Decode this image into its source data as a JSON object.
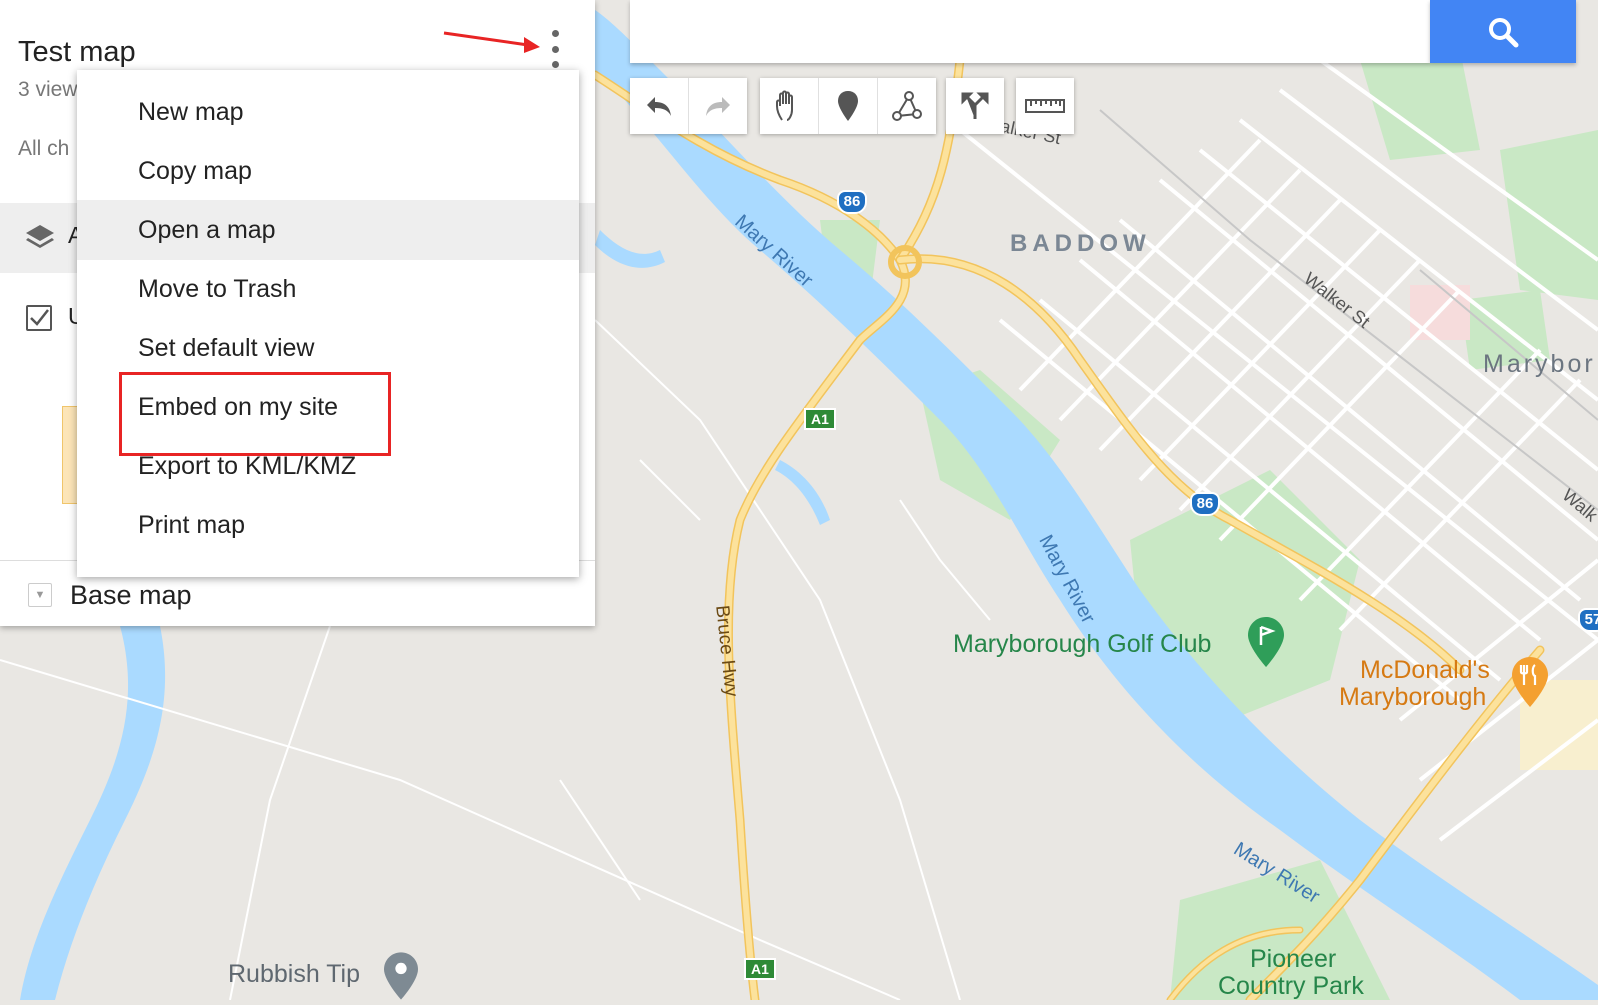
{
  "map": {
    "labels": {
      "baddow": "BADDOW",
      "maryborough_partial": "Marybor",
      "walker_st_1": "alker St",
      "walker_st_2": "Walker St",
      "walker_st_3": "Walk",
      "mary_river_1": "Mary River",
      "mary_river_2": "Mary River",
      "mary_river_3": "Mary River",
      "bruce_hwy": "Bruce Hwy",
      "golf_club": "Maryborough Golf Club",
      "mcdonalds_line1": "McDonald's",
      "mcdonalds_line2": "Maryborough",
      "rubbish_tip": "Rubbish Tip",
      "pioneer_line1": "Pioneer",
      "pioneer_line2": "Country Park"
    },
    "shields": {
      "route86_a": "86",
      "route86_b": "86",
      "a1_a": "A1",
      "a1_b": "A1",
      "route57": "57"
    },
    "colors": {
      "land": "#e9e7e3",
      "water": "#aadaff",
      "park": "#c9e8c5",
      "highway": "#fce29c",
      "highway_edge": "#f2c45c",
      "street": "#ffffff",
      "golf_label": "#26864a",
      "food_label": "#d67a13",
      "pin_grey": "#7e8a93",
      "pin_green": "#2f9e59",
      "pin_orange": "#f4a030"
    }
  },
  "panel": {
    "title": "Test map",
    "views": "3 view",
    "all_changes": "All ch",
    "layer_letter": "A",
    "untitled_letter": "U",
    "basemap_label": "Base map"
  },
  "menu": {
    "items": [
      {
        "label": "New map"
      },
      {
        "label": "Copy map"
      },
      {
        "label": "Open a map"
      },
      {
        "label": "Move to Trash"
      },
      {
        "label": "Set default view"
      },
      {
        "label": "Embed on my site"
      },
      {
        "label": "Export to KML/KMZ"
      },
      {
        "label": "Print map"
      }
    ],
    "hovered_index": 2,
    "highlighted_index": 5
  },
  "search": {
    "placeholder": ""
  },
  "toolbar": {
    "icons": [
      "undo-icon",
      "redo-icon",
      "hand-icon",
      "marker-icon",
      "line-icon",
      "directions-icon",
      "ruler-icon"
    ]
  },
  "annotations": {
    "highlight_color": "#e82424",
    "arrow_color": "#e82424"
  }
}
